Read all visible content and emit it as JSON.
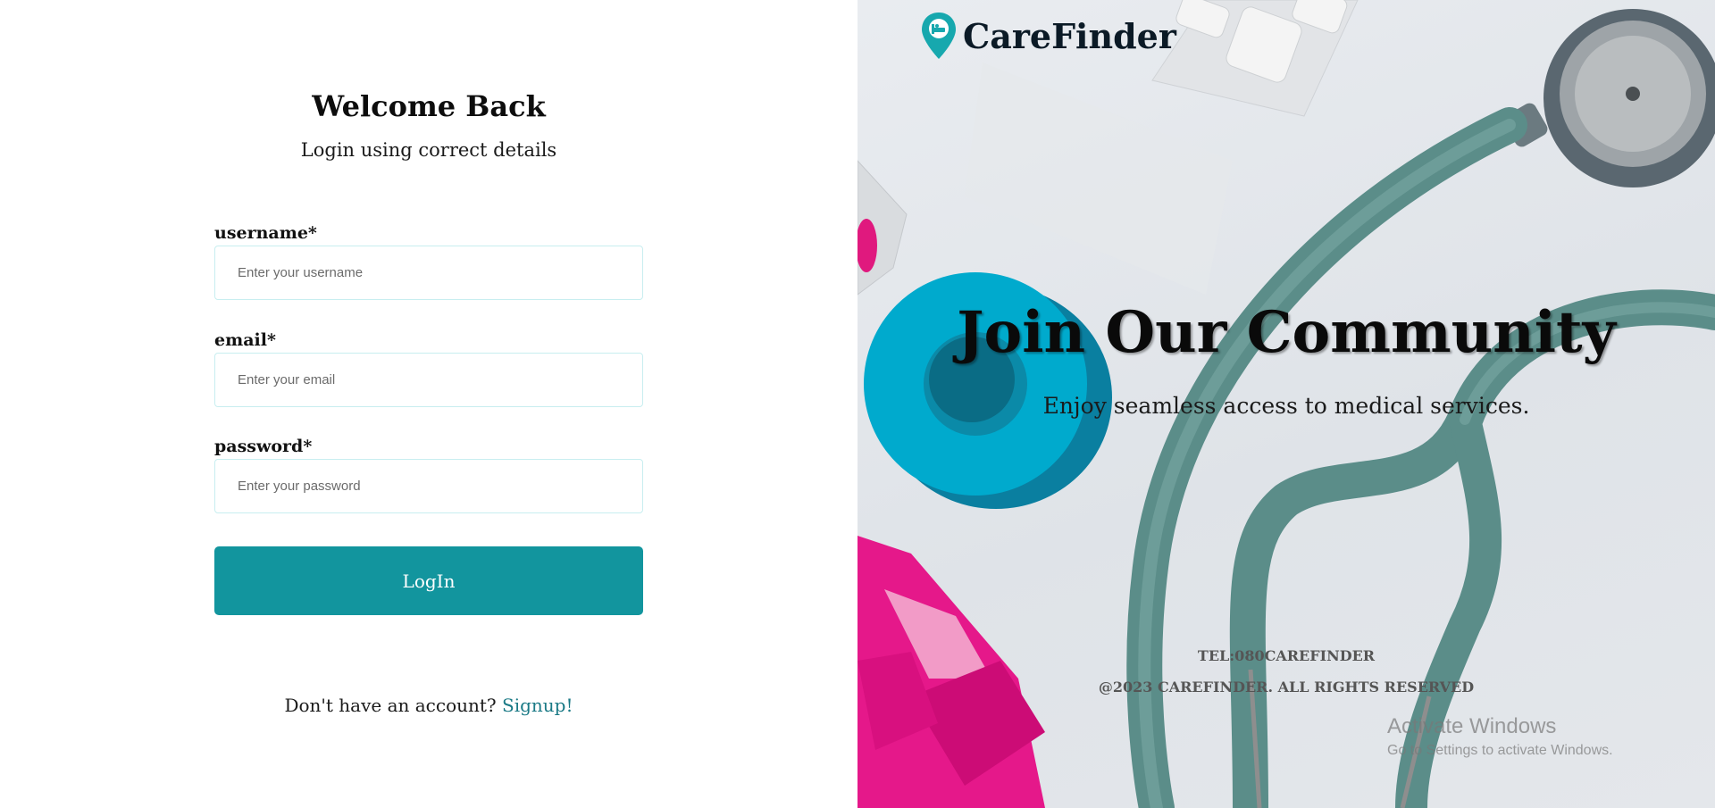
{
  "login": {
    "title": "Welcome Back",
    "subtitle": "Login using correct details",
    "fields": [
      {
        "label": "username*",
        "placeholder": "Enter your username"
      },
      {
        "label": "email*",
        "placeholder": "Enter your email"
      },
      {
        "label": "password*",
        "placeholder": "Enter your password"
      }
    ],
    "button_label": "LogIn",
    "signup_prompt": "Don't have an account?",
    "signup_link": "Signup!"
  },
  "hero": {
    "brand": "CareFinder",
    "title": "Join Our Community",
    "subtitle": "Enjoy seamless access to medical services.",
    "tel": "TEL:080CAREFINDER",
    "copyright": "@2023 CAREFINDER. ALL RIGHTS RESERVED"
  },
  "watermark": {
    "line1": "Activate Windows",
    "line2": "Go to Settings to activate Windows."
  },
  "colors": {
    "accent": "#12959e",
    "link": "#1b7a86",
    "input_border": "#c8eef0",
    "pin": "#17a8ae"
  },
  "icons": {
    "brand": "location-pin-bed-icon"
  }
}
